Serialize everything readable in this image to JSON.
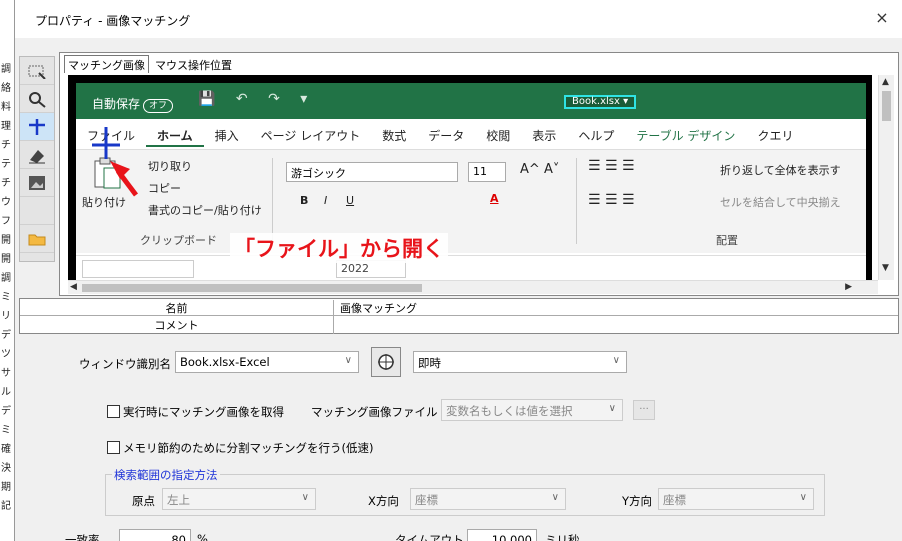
{
  "window": {
    "title": "プロパティ - 画像マッチング",
    "close": "×"
  },
  "bg_chars": [
    "調",
    "絡",
    "料",
    "理",
    "チ",
    "テ",
    "チ",
    "ウ",
    "フ",
    "開",
    "開",
    "調",
    "ミ",
    "リ",
    "デ",
    "ツ",
    "サ",
    "ル",
    "デ",
    "ミ",
    "確",
    "決",
    "期",
    "記"
  ],
  "tabs": [
    "マッチング画像",
    "マウス操作位置"
  ],
  "excel": {
    "autosave_label": "自動保存",
    "autosave_toggle": "オフ",
    "qat": "💾 ↶ ↷ ▾",
    "doc_name": "Book.xlsx ▾",
    "ribbon_tabs": [
      "ファイル",
      "ホーム",
      "挿入",
      "ページ レイアウト",
      "数式",
      "データ",
      "校閲",
      "表示",
      "ヘルプ",
      "テーブル デザイン",
      "クエリ"
    ],
    "clipboard": {
      "paste": "貼り付け",
      "cut": "切り取り",
      "copy": "コピー",
      "format_painter": "書式のコピー/貼り付け",
      "group": "クリップボード"
    },
    "font": {
      "name": "游ゴシック",
      "size": "11",
      "grow": "A^",
      "shrink": "A˅",
      "bold": "B",
      "italic": "I",
      "underline": "U",
      "color": "A"
    },
    "alignment": {
      "wrap": "折り返して全体を表示す",
      "merge": "セルを結合して中央揃え",
      "group": "配置"
    },
    "formula_value": "2022"
  },
  "annotation": "「ファイル」から開く",
  "props": {
    "rows": [
      {
        "key": "名前",
        "value": "画像マッチング"
      },
      {
        "key": "コメント",
        "value": ""
      }
    ]
  },
  "form": {
    "window_id_label": "ウィンドウ識別名",
    "window_id_value": "Book.xlsx-Excel",
    "timing_value": "即時",
    "runtime_checkbox": "実行時にマッチング画像を取得",
    "match_file_label": "マッチング画像ファイル",
    "match_file_placeholder": "変数名もしくは値を選択",
    "browse": "...",
    "memory_checkbox": "メモリ節約のために分割マッチングを行う(低速)",
    "range_legend": "検索範囲の指定方法",
    "origin_label": "原点",
    "origin_value": "左上",
    "xdir_label": "X方向",
    "xdir_value": "座標",
    "ydir_label": "Y方向",
    "ydir_value": "座標",
    "rate_label": "一致率",
    "rate_value": "80",
    "rate_unit": "%",
    "timeout_label": "タイムアウト",
    "timeout_value": "10.000",
    "timeout_unit": "ミリ秒"
  },
  "colors": {
    "excel_green": "#217346",
    "annotation_red": "#e8141a",
    "legend_blue": "#2035d8"
  }
}
